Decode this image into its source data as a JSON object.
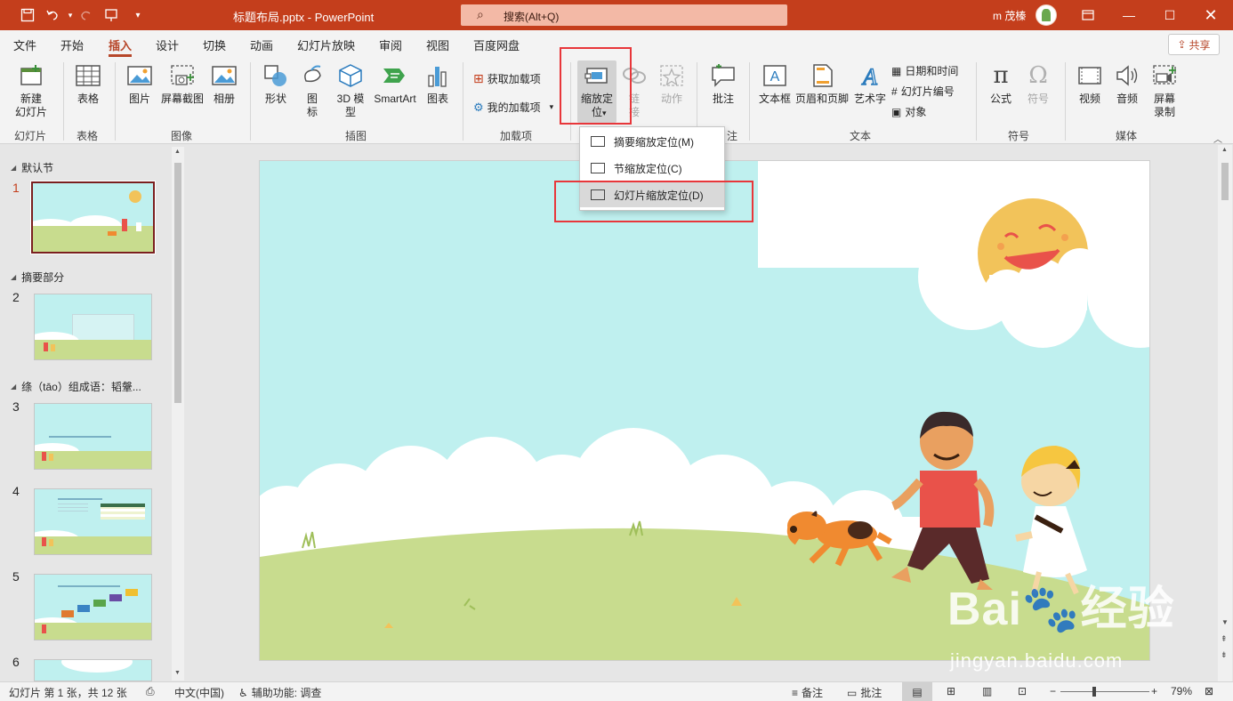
{
  "titlebar": {
    "title": "标题布局.pptx  -  PowerPoint",
    "search_placeholder": "搜索(Alt+Q)",
    "user": "m 茂榛",
    "icons": [
      "autosave-icon",
      "undo-icon",
      "redo-icon",
      "present-icon",
      "customize-icon"
    ]
  },
  "menu": {
    "tabs": [
      "文件",
      "开始",
      "插入",
      "设计",
      "切换",
      "动画",
      "幻灯片放映",
      "审阅",
      "视图",
      "百度网盘"
    ],
    "active": "插入",
    "share": "共享"
  },
  "ribbon": {
    "new_slide": "新建\n幻灯片",
    "table": "表格",
    "picture": "图片",
    "screenshot": "屏幕截图",
    "album": "相册",
    "shapes": "形状",
    "icons": "图\n标",
    "model3d": "3D 模\n型",
    "smartart": "SmartArt",
    "chart": "图表",
    "get_addins": "获取加载项",
    "my_addins": "我的加载项",
    "zoom": "缩放定\n位",
    "link": "链\n接",
    "action": "动作",
    "comment": "批注",
    "textbox": "文本框",
    "header_footer": "页眉和页脚",
    "wordart": "艺术字",
    "date_time": "日期和时间",
    "slide_number": "幻灯片编号",
    "object": "对象",
    "equation": "公式",
    "symbol": "符号",
    "video": "视频",
    "audio": "音频",
    "screen_recording": "屏幕\n录制",
    "groups": [
      "幻灯片",
      "表格",
      "图像",
      "插图",
      "加载项",
      "注",
      "文本",
      "符号",
      "媒体"
    ]
  },
  "zoom_menu": {
    "items": [
      "摘要缩放定位(M)",
      "节缩放定位(C)",
      "幻灯片缩放定位(D)"
    ]
  },
  "slides_pane": {
    "sections": [
      "默认节",
      "摘要部分",
      "绦（tāo）组成语：韬鞶..."
    ],
    "slide_numbers": [
      "1",
      "2",
      "3",
      "4",
      "5",
      "6"
    ]
  },
  "statusbar": {
    "slide_info": "幻灯片 第 1 张，共 12 张",
    "language": "中文(中国)",
    "accessibility": "辅助功能: 调查",
    "notes": "备注",
    "comments": "批注",
    "zoom": "79%"
  },
  "watermark": {
    "text": "Bai",
    "suffix": "经验",
    "url": "jingyan.baidu.com"
  },
  "colors": {
    "accent": "#c43e1c",
    "sky": "#bff0ef",
    "grass": "#c8dc8e",
    "sun": "#f2c35a",
    "highlight": "#e8363a"
  }
}
